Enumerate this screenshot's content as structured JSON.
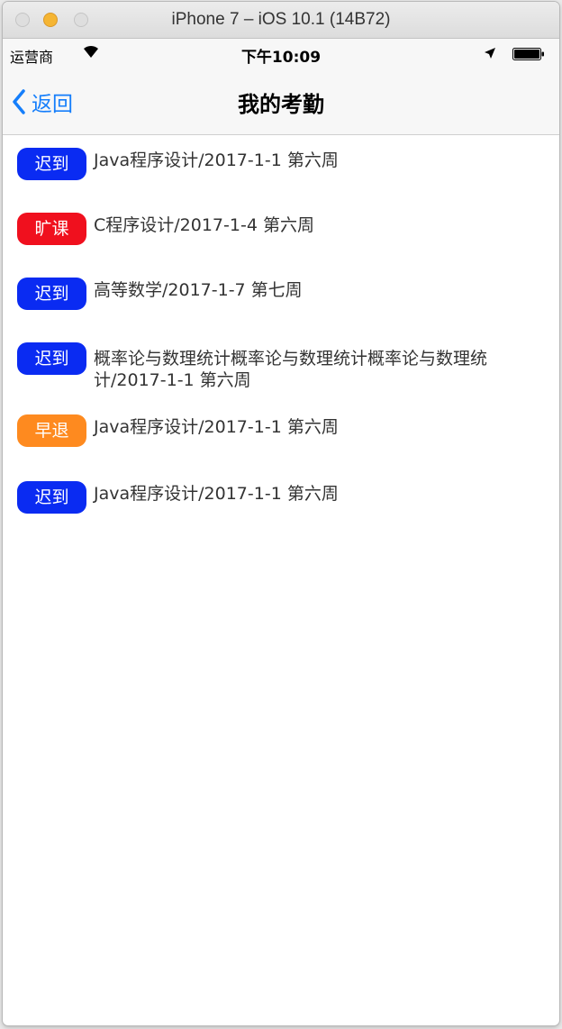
{
  "window": {
    "title": "iPhone 7 – iOS 10.1 (14B72)"
  },
  "statusbar": {
    "carrier": "运营商",
    "time": "下午10:09",
    "icons": [
      "wifi-icon",
      "location-arrow-icon",
      "battery-icon"
    ]
  },
  "navbar": {
    "back_label": "返回",
    "title": "我的考勤",
    "back_icon": "chevron-left-icon"
  },
  "colors": {
    "accent": "#157efb",
    "late": "#0a2bf2",
    "absent": "#f0101e",
    "early_leave": "#fe8a1f"
  },
  "records": [
    {
      "status": "迟到",
      "status_color": "#0a2bf2",
      "text": "Java程序设计/2017-1-1 第六周"
    },
    {
      "status": "旷课",
      "status_color": "#f0101e",
      "text": "C程序设计/2017-1-4 第六周"
    },
    {
      "status": "迟到",
      "status_color": "#0a2bf2",
      "text": "高等数学/2017-1-7 第七周"
    },
    {
      "status": "迟到",
      "status_color": "#0a2bf2",
      "text": "概率论与数理统计概率论与数理统计概率论与数理统计/2017-1-1 第六周"
    },
    {
      "status": "早退",
      "status_color": "#fe8a1f",
      "text": "Java程序设计/2017-1-1 第六周"
    },
    {
      "status": "迟到",
      "status_color": "#0a2bf2",
      "text": "Java程序设计/2017-1-1 第六周"
    }
  ]
}
